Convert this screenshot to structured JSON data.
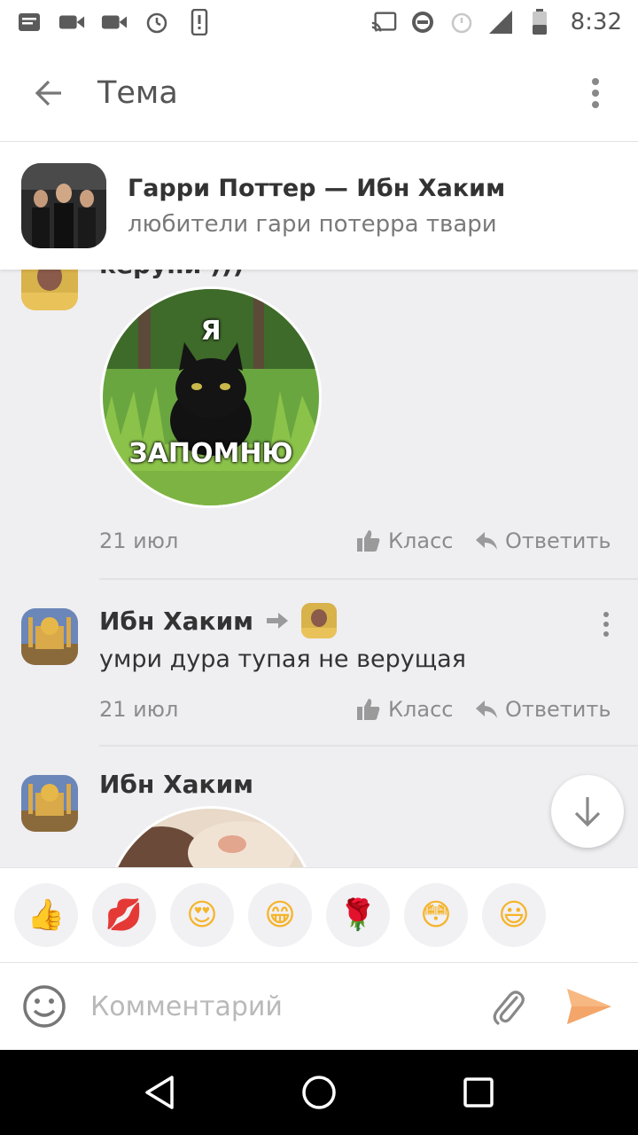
{
  "status_bar": {
    "time": "8:32"
  },
  "app_bar": {
    "title": "Тема"
  },
  "group": {
    "name": "Гарри Поттер — Ибн Хаким",
    "subtitle": "любители гари потерра твари"
  },
  "comments": [
    {
      "author_partial": "керуни )))",
      "sticker_top_text": "Я",
      "sticker_bottom_text": "ЗАПОМНЮ",
      "date": "21 июл",
      "like_label": "Класс",
      "reply_label": "Ответить"
    },
    {
      "author": "Ибн Хаким",
      "text": "умри дура тупая не верущая",
      "date": "21 июл",
      "like_label": "Класс",
      "reply_label": "Ответить"
    },
    {
      "author": "Ибн Хаким"
    }
  ],
  "reactions": [
    {
      "icon": "thumbs-up-icon",
      "glyph": "👍"
    },
    {
      "icon": "kiss-icon",
      "glyph": "💋"
    },
    {
      "icon": "heart-eyes-icon",
      "glyph": "😍"
    },
    {
      "icon": "grin-icon",
      "glyph": "😁"
    },
    {
      "icon": "rose-icon",
      "glyph": "🌹"
    },
    {
      "icon": "blush-icon",
      "glyph": "😳"
    },
    {
      "icon": "smile-icon",
      "glyph": "😃"
    }
  ],
  "input": {
    "placeholder": "Комментарий"
  },
  "colors": {
    "accent": "#f7a35c",
    "text_primary": "#333333",
    "text_secondary": "#8c8c8c",
    "background": "#efeef1"
  }
}
